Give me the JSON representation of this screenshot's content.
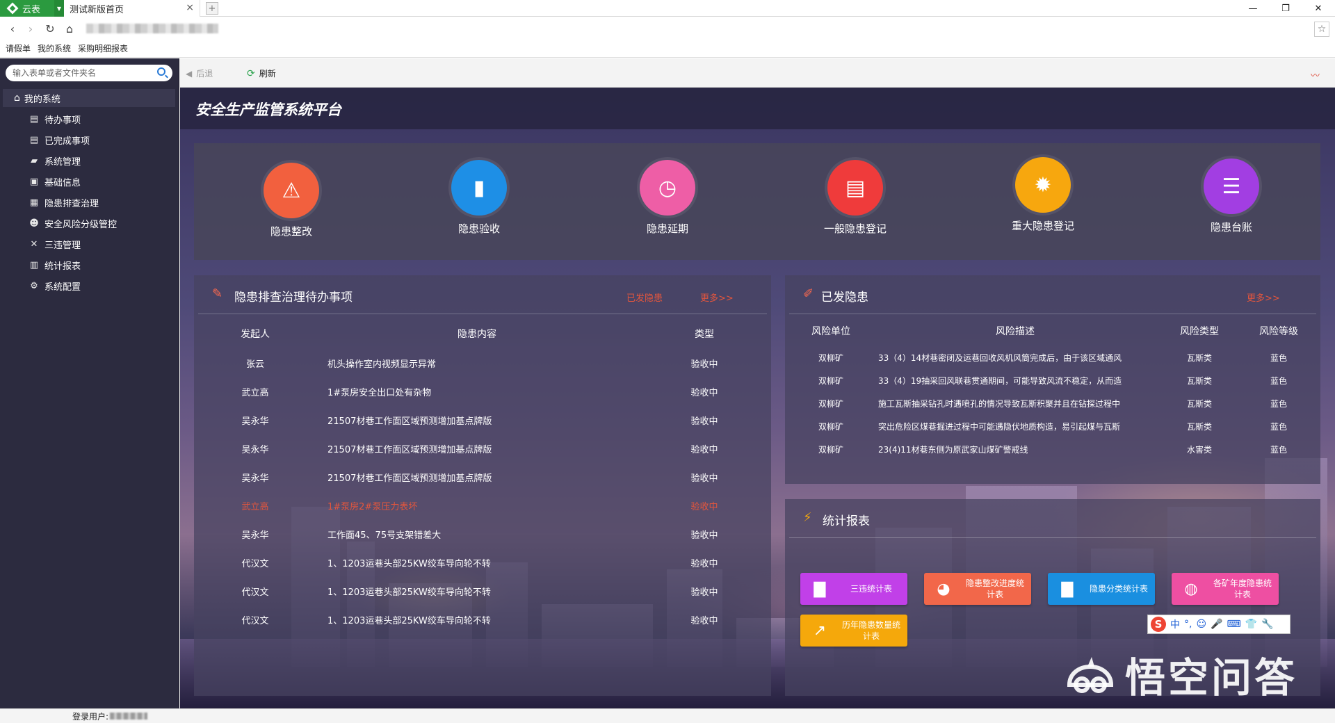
{
  "browser": {
    "app_name": "云表",
    "tab_title": "测试新版首页",
    "tab_close": "×",
    "new_tab": "+",
    "window_buttons": [
      "—",
      "❐",
      "✕"
    ],
    "bookmarks": [
      "请假单",
      "我的系统",
      "采购明细报表"
    ]
  },
  "sidebar": {
    "search_placeholder": "输入表单或者文件夹名",
    "root_label": "我的系统",
    "items": [
      {
        "label": "待办事项",
        "icon": "list-icon"
      },
      {
        "label": "已完成事项",
        "icon": "list-icon"
      },
      {
        "label": "系统管理",
        "icon": "folder-icon"
      },
      {
        "label": "基础信息",
        "icon": "id-card-icon"
      },
      {
        "label": "隐患排查治理",
        "icon": "form-icon"
      },
      {
        "label": "安全风险分级管控",
        "icon": "users-icon"
      },
      {
        "label": "三违管理",
        "icon": "tools-icon"
      },
      {
        "label": "统计报表",
        "icon": "bar-chart-icon"
      },
      {
        "label": "系统配置",
        "icon": "gear-icon"
      }
    ]
  },
  "toolbar": {
    "back_label": "后退",
    "refresh_label": "刷新"
  },
  "main": {
    "title": "安全生产监管系统平台",
    "quick_actions": [
      {
        "label": "隐患整改",
        "icon": "warning-icon",
        "color": "#f2603e"
      },
      {
        "label": "隐患验收",
        "icon": "book-icon",
        "color": "#1e8fe6"
      },
      {
        "label": "隐患延期",
        "icon": "clock-icon",
        "color": "#ee5ea6"
      },
      {
        "label": "一般隐患登记",
        "icon": "document-icon",
        "color": "#ef3b3b"
      },
      {
        "label": "重大隐患登记",
        "icon": "alarm-icon",
        "color": "#f7a70e"
      },
      {
        "label": "隐患台账",
        "icon": "ledger-icon",
        "color": "#a23ee2"
      }
    ]
  },
  "todo_panel": {
    "title": "隐患排查治理待办事项",
    "link_issued": "已发隐患",
    "link_more": "更多>>",
    "columns": [
      "发起人",
      "隐患内容",
      "类型"
    ],
    "rows": [
      {
        "person": "张云",
        "content": "机头操作室内视频显示异常",
        "type": "验收中",
        "highlight": false
      },
      {
        "person": "武立高",
        "content": "1#泵房安全出口处有杂物",
        "type": "验收中",
        "highlight": false
      },
      {
        "person": "吴永华",
        "content": "21507材巷工作面区域预测增加基点牌版",
        "type": "验收中",
        "highlight": false
      },
      {
        "person": "吴永华",
        "content": "21507材巷工作面区域预测增加基点牌版",
        "type": "验收中",
        "highlight": false
      },
      {
        "person": "吴永华",
        "content": "21507材巷工作面区域预测增加基点牌版",
        "type": "验收中",
        "highlight": false
      },
      {
        "person": "武立高",
        "content": "1#泵房2#泵压力表坏",
        "type": "验收中",
        "highlight": true
      },
      {
        "person": "吴永华",
        "content": "工作面45、75号支架错差大",
        "type": "验收中",
        "highlight": false
      },
      {
        "person": "代汉文",
        "content": "1、1203运巷头部25KW绞车导向轮不转",
        "type": "验收中",
        "highlight": false
      },
      {
        "person": "代汉文",
        "content": "1、1203运巷头部25KW绞车导向轮不转",
        "type": "验收中",
        "highlight": false
      },
      {
        "person": "代汉文",
        "content": "1、1203运巷头部25KW绞车导向轮不转",
        "type": "验收中",
        "highlight": false
      }
    ]
  },
  "issued_panel": {
    "title": "已发隐患",
    "link_more": "更多>>",
    "columns": [
      "风险单位",
      "风险描述",
      "风险类型",
      "风险等级"
    ],
    "rows": [
      {
        "unit": "双柳矿",
        "desc": "33（4）14材巷密闭及运巷回收风机风筒完成后，由于该区域通风",
        "type": "瓦斯类",
        "level": "蓝色"
      },
      {
        "unit": "双柳矿",
        "desc": "33（4）19抽采回风联巷贯通期间，可能导致风流不稳定，从而造",
        "type": "瓦斯类",
        "level": "蓝色"
      },
      {
        "unit": "双柳矿",
        "desc": "施工瓦斯抽采钻孔时遇喷孔的情况导致瓦斯积聚并且在钻探过程中",
        "type": "瓦斯类",
        "level": "蓝色"
      },
      {
        "unit": "双柳矿",
        "desc": "突出危险区煤巷掘进过程中可能遇隐伏地质构造，易引起煤与瓦斯",
        "type": "瓦斯类",
        "level": "蓝色"
      },
      {
        "unit": "双柳矿",
        "desc": "23(4)11材巷东侧为原武家山煤矿警戒线",
        "type": "水害类",
        "level": "蓝色"
      }
    ]
  },
  "stats_panel": {
    "title": "统计报表",
    "buttons": [
      {
        "label": "三违统计表",
        "color": "#c140e8",
        "icon": "bar-chart-icon"
      },
      {
        "label": "隐患整改进度统计表",
        "color": "#f2674a",
        "icon": "pie-chart-icon"
      },
      {
        "label": "隐患分类统计表",
        "color": "#1a8fe0",
        "icon": "bar-chart-icon"
      },
      {
        "label": "各矿年度隐患统计表",
        "color": "#ee4fa2",
        "icon": "donut-chart-icon"
      },
      {
        "label": "历年隐患数量统计表",
        "color": "#f5a80b",
        "icon": "growth-chart-icon"
      }
    ]
  },
  "ime": {
    "logo": "S",
    "mode": "中",
    "items": [
      "°,",
      "☺",
      "🎤",
      "⌨",
      "👕",
      "🔧"
    ]
  },
  "watermark": "悟空问答",
  "status": {
    "login_label": "登录用户:"
  }
}
